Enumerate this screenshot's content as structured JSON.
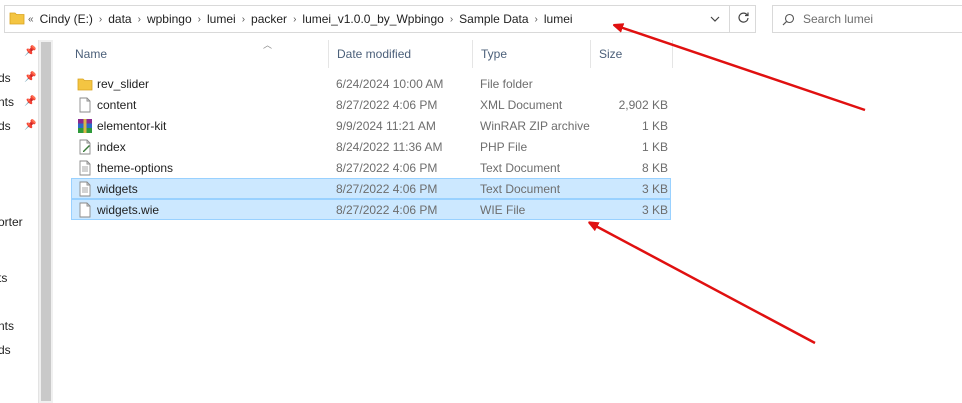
{
  "address_bar": {
    "overflow": "«",
    "crumbs": [
      "Cindy (E:)",
      "data",
      "wpbingo",
      "lumei",
      "packer",
      "lumei_v1.0.0_by_Wpbingo",
      "Sample Data",
      "lumei"
    ]
  },
  "search": {
    "placeholder": "Search lumei"
  },
  "nav": {
    "items": [
      "ds",
      "nts",
      "ds",
      "orter",
      "ts",
      "nts",
      "ds"
    ]
  },
  "columns": {
    "name": "Name",
    "date": "Date modified",
    "type": "Type",
    "size": "Size"
  },
  "files": [
    {
      "name": "rev_slider",
      "date": "6/24/2024 10:00 AM",
      "type": "File folder",
      "size": "",
      "icon": "folder-icon",
      "selected": false
    },
    {
      "name": "content",
      "date": "8/27/2022 4:06 PM",
      "type": "XML Document",
      "size": "2,902 KB",
      "icon": "xml-file-icon",
      "selected": false
    },
    {
      "name": "elementor-kit",
      "date": "9/9/2024 11:21 AM",
      "type": "WinRAR ZIP archive",
      "size": "1 KB",
      "icon": "winrar-archive-icon",
      "selected": false
    },
    {
      "name": "index",
      "date": "8/24/2022 11:36 AM",
      "type": "PHP File",
      "size": "1 KB",
      "icon": "php-file-icon",
      "selected": false
    },
    {
      "name": "theme-options",
      "date": "8/27/2022 4:06 PM",
      "type": "Text Document",
      "size": "8 KB",
      "icon": "text-file-icon",
      "selected": false
    },
    {
      "name": "widgets",
      "date": "8/27/2022 4:06 PM",
      "type": "Text Document",
      "size": "3 KB",
      "icon": "text-file-icon",
      "selected": true
    },
    {
      "name": "widgets.wie",
      "date": "8/27/2022 4:06 PM",
      "type": "WIE File",
      "size": "3 KB",
      "icon": "blank-file-icon",
      "selected": true
    }
  ],
  "colors": {
    "selection_bg": "#cce8ff",
    "selection_border": "#99d1ff",
    "annotation_arrow": "#e01010",
    "folder": "#f4c542"
  }
}
